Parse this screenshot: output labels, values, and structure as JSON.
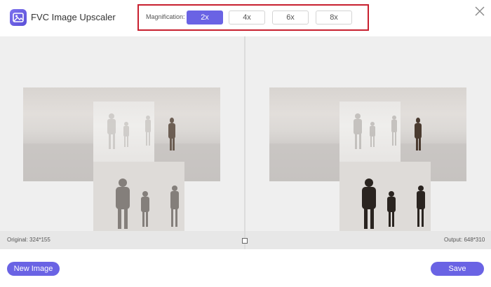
{
  "app": {
    "title": "FVC Image Upscaler",
    "accent_color": "#6a63e4",
    "highlight_color": "#c8202f"
  },
  "magnification": {
    "label": "Magnification:",
    "options": [
      "2x",
      "4x",
      "6x",
      "8x"
    ],
    "selected": "2x"
  },
  "icons": {
    "logo": "image-upscale-logo-icon",
    "close": "close-icon",
    "compare": "compare-toggle-icon"
  },
  "original": {
    "dimensions_label": "Original: 324*155"
  },
  "output": {
    "dimensions_label": "Output: 648*310"
  },
  "actions": {
    "new_image_label": "New Image",
    "save_label": "Save"
  }
}
